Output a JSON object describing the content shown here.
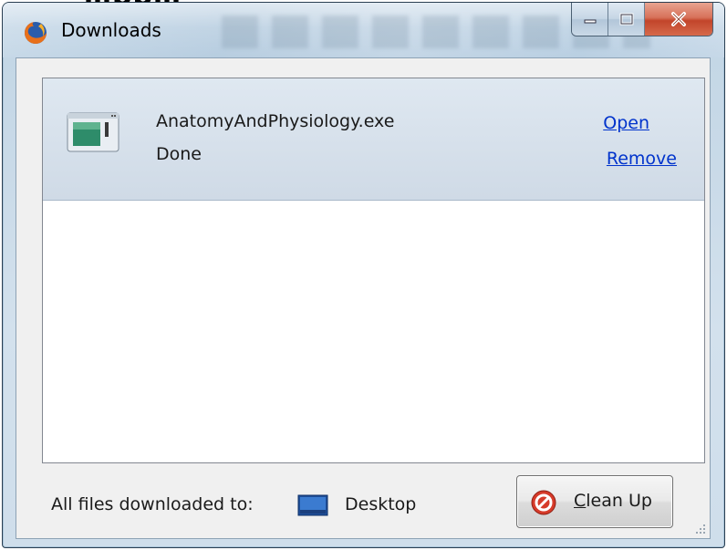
{
  "page_behind_text": "…pp…",
  "window": {
    "title": "Downloads",
    "icons": {
      "app": "firefox-icon",
      "minimize": "minimize-icon",
      "maximize": "maximize-icon",
      "close": "close-icon"
    }
  },
  "downloads": [
    {
      "file_name": "AnatomyAndPhysiology.exe",
      "status": "Done",
      "icon": "executable-file-icon",
      "actions": {
        "open": "Open",
        "remove": "Remove"
      }
    }
  ],
  "footer": {
    "label": "All files downloaded to:",
    "folder_icon": "desktop-icon",
    "folder": "Desktop",
    "cleanup_button": {
      "mnemonic": "C",
      "rest": "lean Up",
      "icon": "no-entry-icon"
    }
  },
  "colors": {
    "link": "#0033cc",
    "row_highlight": "#d6e0eb",
    "close_button": "#c2452a"
  }
}
